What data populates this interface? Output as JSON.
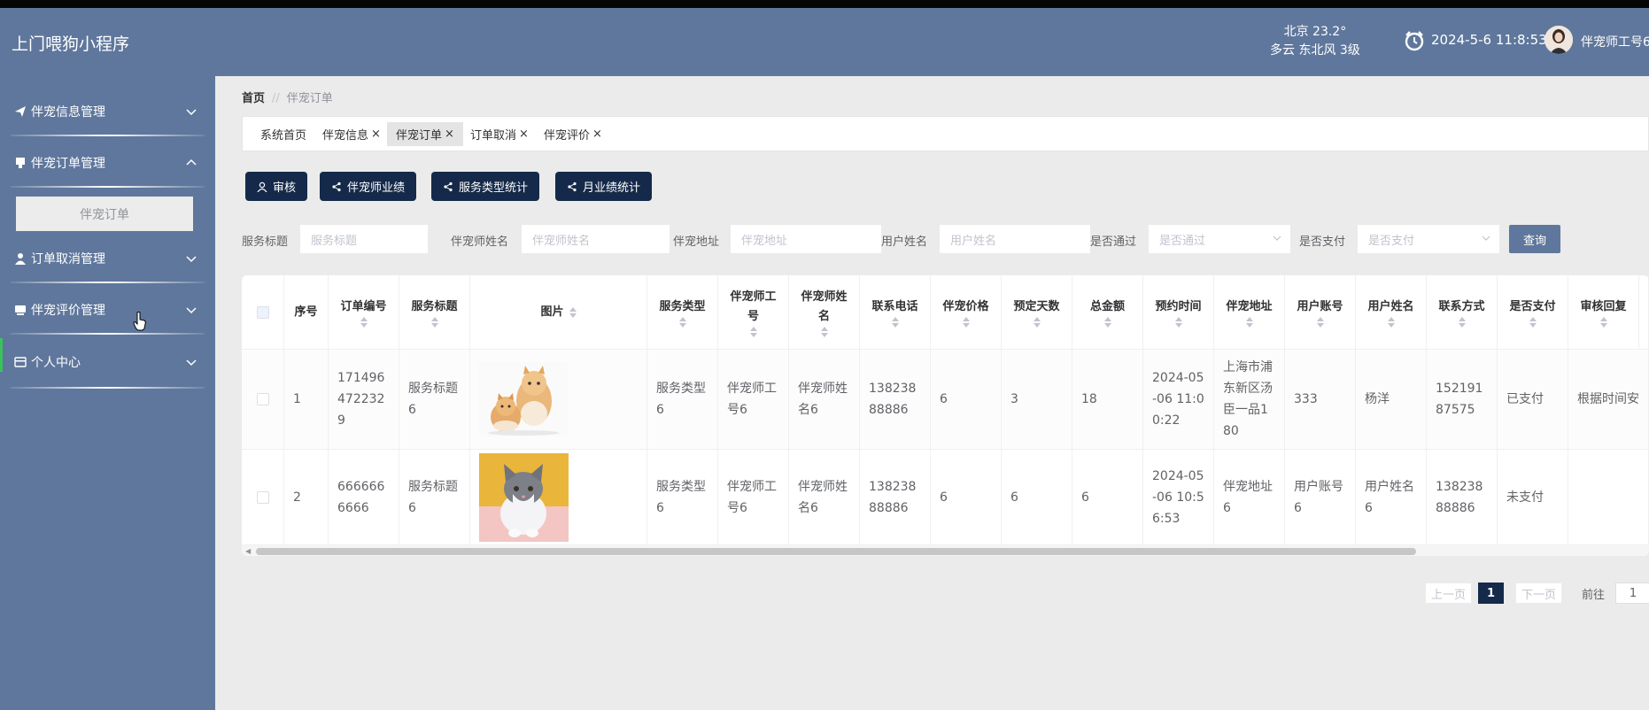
{
  "app": {
    "title": "上门喂狗小程序"
  },
  "header": {
    "weather_city_temp": "北京  23.2°",
    "weather_desc": "多云  东北风  3级",
    "datetime": "2024-5-6 11:8:53",
    "username": "伴宠师工号6"
  },
  "sidebar": {
    "groups": [
      {
        "label": "伴宠信息管理",
        "icon": "paper-plane-icon"
      },
      {
        "label": "伴宠订单管理",
        "icon": "order-icon",
        "expanded": true,
        "children": [
          {
            "label": "伴宠订单"
          }
        ]
      },
      {
        "label": "订单取消管理",
        "icon": "user-icon"
      },
      {
        "label": "伴宠评价管理",
        "icon": "comment-icon"
      },
      {
        "label": "个人中心",
        "icon": "card-icon"
      }
    ]
  },
  "breadcrumb": {
    "home": "首页",
    "separator": "//",
    "current": "伴宠订单"
  },
  "tabs": [
    {
      "label": "系统首页",
      "closable": false
    },
    {
      "label": "伴宠信息",
      "closable": true
    },
    {
      "label": "伴宠订单",
      "closable": true,
      "active": true
    },
    {
      "label": "订单取消",
      "closable": true
    },
    {
      "label": "伴宠评价",
      "closable": true
    }
  ],
  "tab_close": "×",
  "actions": [
    {
      "label": "审核",
      "icon": "user-icon"
    },
    {
      "label": "伴宠师业绩",
      "icon": "share-icon"
    },
    {
      "label": "服务类型统计",
      "icon": "share-icon"
    },
    {
      "label": "月业绩统计",
      "icon": "share-icon"
    }
  ],
  "filters": [
    {
      "label": "服务标题",
      "placeholder": "服务标题"
    },
    {
      "label": "伴宠师姓名",
      "placeholder": "伴宠师姓名"
    },
    {
      "label": "伴宠地址",
      "placeholder": "伴宠地址"
    },
    {
      "label": "用户姓名",
      "placeholder": "用户姓名"
    },
    {
      "label": "是否通过",
      "placeholder": "是否通过"
    },
    {
      "label": "是否支付",
      "placeholder": "是否支付"
    }
  ],
  "query_label": "查询",
  "table": {
    "headers": [
      "序号",
      "订单编号",
      "服务标题",
      "图片",
      "服务类型",
      "伴宠师工号",
      "伴宠师姓名",
      "联系电话",
      "伴宠价格",
      "预定天数",
      "总金额",
      "预约时间",
      "伴宠地址",
      "用户账号",
      "用户姓名",
      "联系方式",
      "是否支付",
      "审核回复"
    ],
    "rows": [
      [
        "1",
        "1714964722329",
        "服务标题6",
        "image:cats",
        "服务类型6",
        "伴宠师工号6",
        "伴宠师姓名6",
        "13823888886",
        "6",
        "3",
        "18",
        "2024-05-06 11:00:22",
        "上海市浦东新区汤臣一品180",
        "333",
        "杨洋",
        "15219187575",
        "已支付",
        "根据时间安"
      ],
      [
        "2",
        "6666666666",
        "服务标题6",
        "image:kitten",
        "服务类型6",
        "伴宠师工号6",
        "伴宠师姓名6",
        "13823888886",
        "6",
        "6",
        "6",
        "2024-05-06 10:56:53",
        "伴宠地址6",
        "用户账号6",
        "用户姓名6",
        "13823888886",
        "未支付",
        ""
      ]
    ]
  },
  "pagination": {
    "prev": "上一页",
    "current": "1",
    "next": "下一页",
    "goto": "前往",
    "goto_value": "1"
  },
  "colors": {
    "header_bg": "#5f779c",
    "button_dark": "#152a4a",
    "accent_green": "#3bc25c"
  }
}
